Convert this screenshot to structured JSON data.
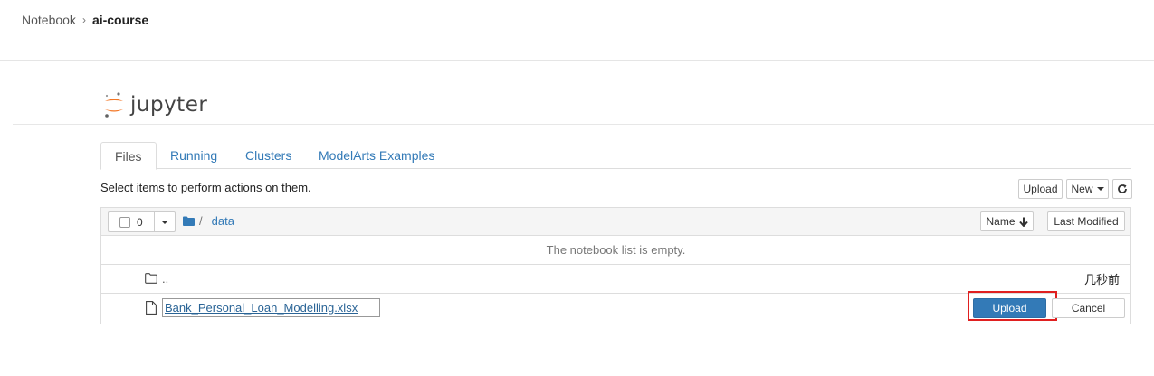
{
  "breadcrumb": {
    "root": "Notebook",
    "separator": "›",
    "current": "ai-course"
  },
  "logo": {
    "text": "jupyter"
  },
  "tabs": [
    {
      "label": "Files",
      "active": true
    },
    {
      "label": "Running",
      "active": false
    },
    {
      "label": "Clusters",
      "active": false
    },
    {
      "label": "ModelArts Examples",
      "active": false
    }
  ],
  "toolbar": {
    "hint": "Select items to perform actions on them.",
    "upload_label": "Upload",
    "new_label": "New",
    "refresh_icon": "refresh-icon"
  },
  "list_header": {
    "selected_count": "0",
    "path_sep": "/",
    "folder": "data",
    "sort_name_label": "Name",
    "sort_arrow": "🡣",
    "last_modified_label": "Last Modified"
  },
  "list": {
    "empty_message": "The notebook list is empty.",
    "parent_dir": {
      "name": "..",
      "modified": "几秒前"
    },
    "pending_upload": {
      "filename": "Bank_Personal_Loan_Modelling.xlsx",
      "upload_label": "Upload",
      "cancel_label": "Cancel"
    }
  },
  "colors": {
    "accent": "#337ab7",
    "highlight": "#e02020",
    "logo_orange": "#f37726"
  }
}
